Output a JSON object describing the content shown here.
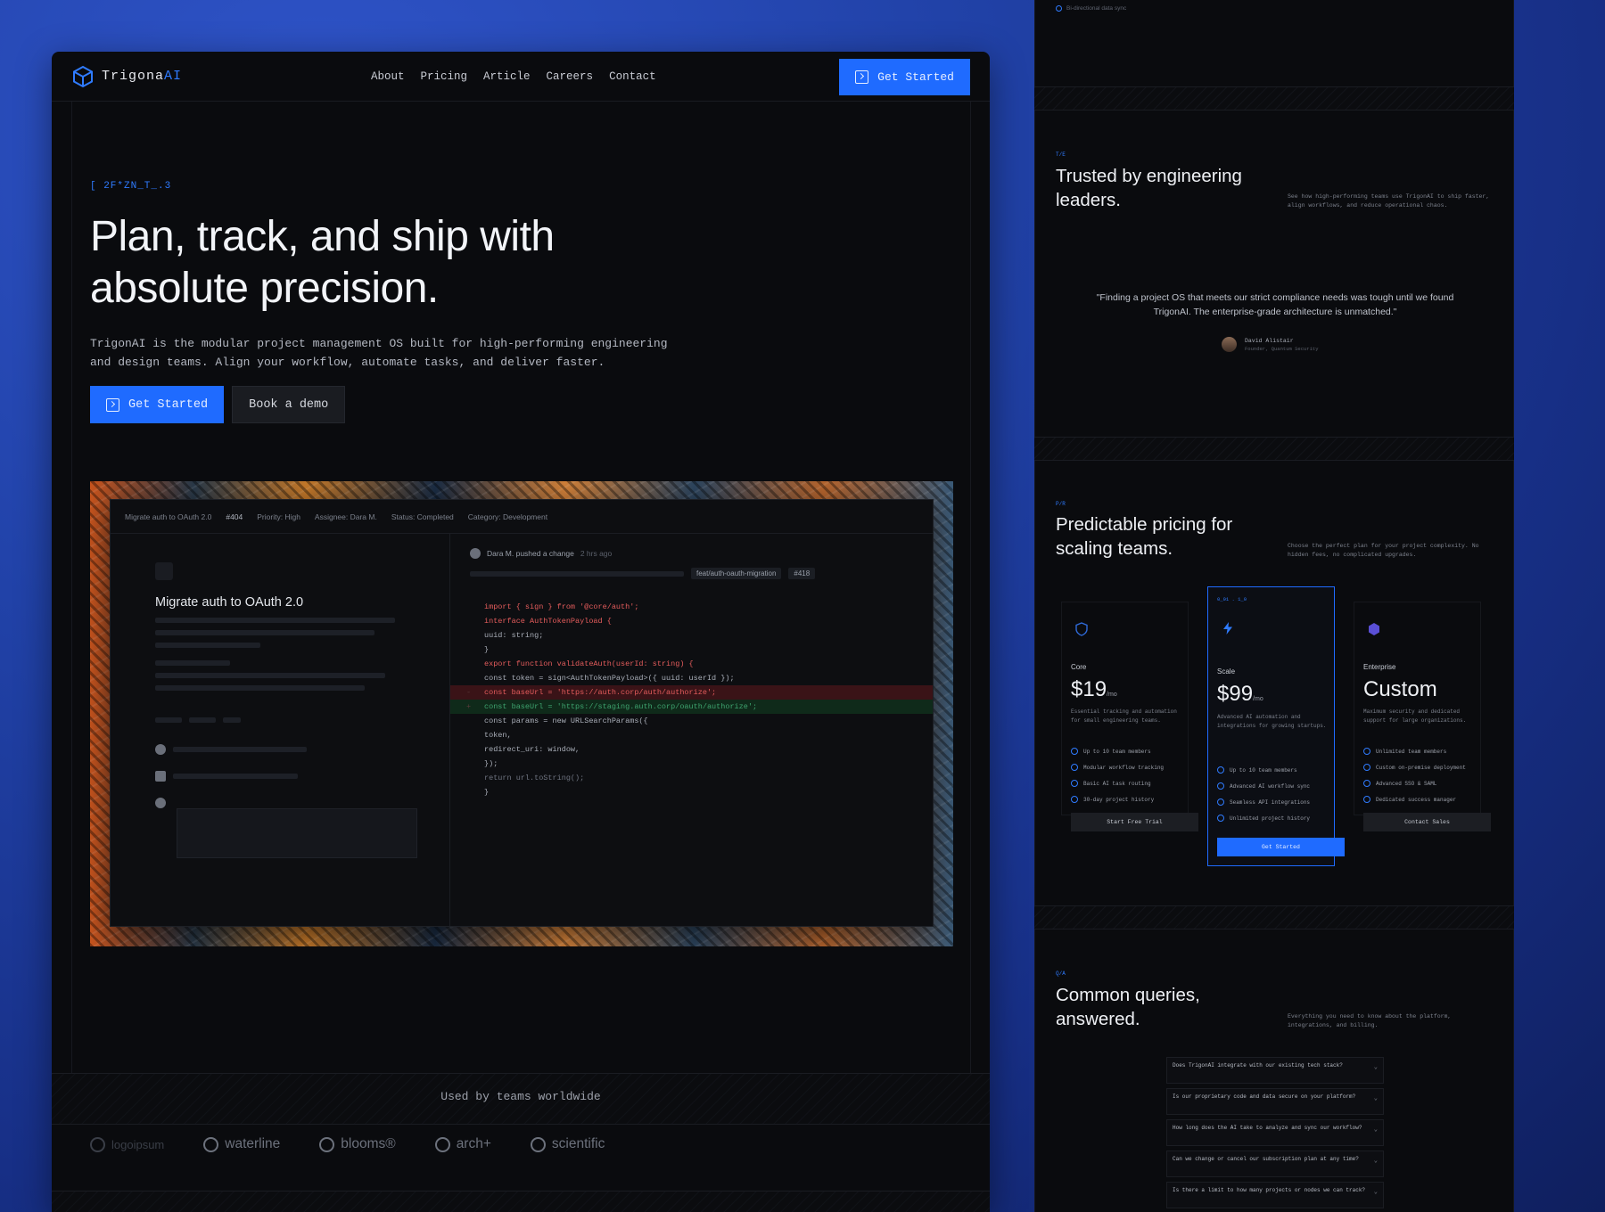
{
  "nav": {
    "brand_main": "Trigona",
    "brand_ai": "AI",
    "links": [
      "About",
      "Pricing",
      "Article",
      "Careers",
      "Contact"
    ],
    "cta": "Get Started"
  },
  "hero": {
    "eyebrow": "[ 2F*ZN_T_.3",
    "title": "Plan, track, and ship with absolute precision.",
    "description": "TrigonAI is the modular project management OS built for high-performing engineering and design teams. Align your workflow, automate tasks, and deliver faster.",
    "primary_cta": "Get Started",
    "secondary_cta": "Book a demo"
  },
  "preview": {
    "bar": [
      "Migrate auth to OAuth 2.0",
      "#404",
      "Priority: High",
      "Assignee: Dara M.",
      "Status: Completed",
      "Category: Development"
    ],
    "task_title": "Migrate auth to OAuth 2.0",
    "commit_author": "Dara M. pushed a change",
    "commit_time": "2 hrs ago",
    "chip_1": "feat/auth-oauth-migration",
    "chip_2": "#418"
  },
  "code_lines": [
    {
      "kind": "k",
      "text": "import { sign } from '@core/auth';"
    },
    {
      "kind": "t",
      "text": ""
    },
    {
      "kind": "k",
      "text": "interface AuthTokenPayload {"
    },
    {
      "kind": "t",
      "text": "  uuid: string;"
    },
    {
      "kind": "t",
      "text": "}"
    },
    {
      "kind": "t",
      "text": ""
    },
    {
      "kind": "k",
      "text": "export function validateAuth(userId: string) {"
    },
    {
      "kind": "t",
      "text": "  const token = sign<AuthTokenPayload>({ uuid: userId });"
    },
    {
      "kind": "t",
      "text": ""
    },
    {
      "kind": "del",
      "text": "  const baseUrl = 'https://auth.corp/auth/authorize';"
    },
    {
      "kind": "add",
      "text": "  const baseUrl = 'https://staging.auth.corp/oauth/authorize';"
    },
    {
      "kind": "t",
      "text": "  const params = new URLSearchParams({"
    },
    {
      "kind": "t",
      "text": "    token,"
    },
    {
      "kind": "t",
      "text": "    redirect_uri: window,"
    },
    {
      "kind": "t",
      "text": "  });"
    },
    {
      "kind": "t",
      "text": ""
    },
    {
      "kind": "m",
      "text": "  return url.toString();"
    },
    {
      "kind": "t",
      "text": "}"
    }
  ],
  "used_by": {
    "label": "Used by teams worldwide",
    "brands": [
      "logoipsum",
      "waterline",
      "blooms®",
      "arch+",
      "scientific"
    ]
  },
  "right": {
    "top_note": "Bi-directional data sync",
    "testimonials": {
      "eyebrow": "T/E",
      "title": "Trusted by engineering leaders.",
      "aside": "See how high-performing teams use TrigonAI to ship faster, align workflows, and reduce operational chaos.",
      "quote": "\"Finding a project OS that meets our strict compliance needs was tough until we found TrigonAI. The enterprise-grade architecture is unmatched.\"",
      "author_name": "David Alistair",
      "author_role": "Founder, Quantum Security"
    },
    "pricing": {
      "eyebrow": "P/R",
      "title": "Predictable pricing for scaling teams.",
      "aside": "Choose the perfect plan for your project complexity. No hidden fees, no complicated upgrades.",
      "featured_tag": "0_01   . 1_0",
      "plans": [
        {
          "name": "Core",
          "price": "$19",
          "unit": "/mo",
          "desc": "Essential tracking and automation for small engineering teams.",
          "features": [
            "Up to 10 team members",
            "Modular workflow tracking",
            "Basic AI task routing",
            "30-day project history"
          ],
          "cta": "Start Free Trial"
        },
        {
          "name": "Scale",
          "price": "$99",
          "unit": "/mo",
          "desc": "Advanced AI automation and integrations for growing startups.",
          "features": [
            "Up to 10 team members",
            "Advanced AI workflow sync",
            "Seamless API integrations",
            "Unlimited project history"
          ],
          "cta": "Get Started"
        },
        {
          "name": "Enterprise",
          "price": "Custom",
          "unit": "",
          "desc": "Maximum security and dedicated support for large organizations.",
          "features": [
            "Unlimited team members",
            "Custom on-premise deployment",
            "Advanced SSO & SAML",
            "Dedicated success manager"
          ],
          "cta": "Contact Sales"
        }
      ]
    },
    "faq": {
      "eyebrow": "Q/A",
      "title": "Common queries, answered.",
      "aside": "Everything you need to know about the platform, integrations, and billing.",
      "questions": [
        "Does TrigonAI integrate with our existing tech stack?",
        "Is our proprietary code and data secure on your platform?",
        "How long does the AI take to analyze and sync our workflow?",
        "Can we change or cancel our subscription plan at any time?",
        "Is there a limit to how many projects or nodes we can track?"
      ]
    }
  },
  "colors": {
    "accent": "#1f6bff",
    "background": "#0a0b0e",
    "backdrop": "#2142a8"
  }
}
